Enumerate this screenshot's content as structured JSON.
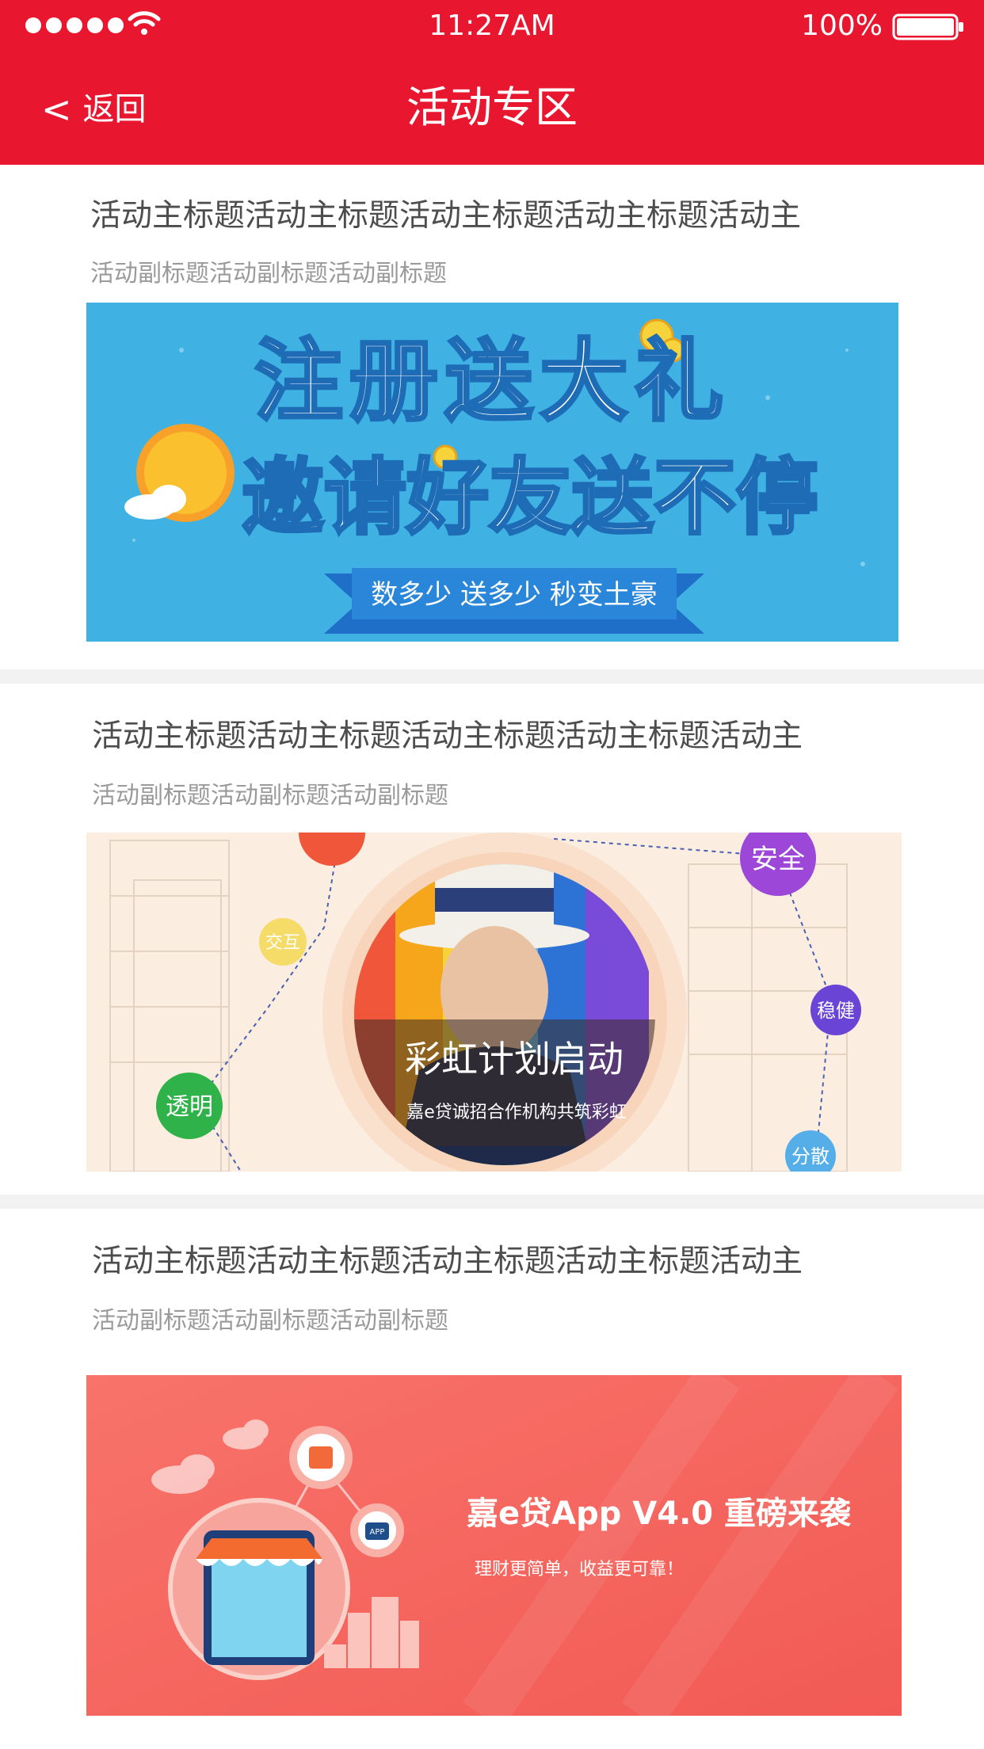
{
  "status_bar": {
    "time": "11:27AM",
    "battery_percent": "100%",
    "signal_icon": "signal-dots-icon",
    "wifi_icon": "wifi-icon",
    "battery_icon": "battery-icon"
  },
  "nav": {
    "back_icon": "<",
    "back_label": "返回",
    "title": "活动专区"
  },
  "colors": {
    "brand_red": "#e8172f",
    "divider": "#f2f2f2",
    "title_text": "#4d4d4d",
    "subtitle_text": "#9a9a9a"
  },
  "activities": [
    {
      "title": "活动主标题活动主标题活动主标题活动主标题活动主",
      "subtitle": "活动副标题活动副标题活动副标题",
      "banner": {
        "headline1": "注册送大礼",
        "headline2": "邀请好友送不停",
        "ribbon": "数多少 送多少 秒变土豪"
      }
    },
    {
      "title": "活动主标题活动主标题活动主标题活动主标题活动主",
      "subtitle": "活动副标题活动副标题活动副标题",
      "banner": {
        "headline": "彩虹计划启动",
        "subline": "嘉e贷诚招合作机构共筑彩虹",
        "tags": [
          "安全",
          "稳健",
          "分散",
          "透明",
          "交互"
        ]
      }
    },
    {
      "title": "活动主标题活动主标题活动主标题活动主标题活动主",
      "subtitle": "活动副标题活动副标题活动副标题",
      "banner": {
        "headline": "嘉e贷App V4.0 重磅来袭",
        "subline": "理财更简单，收益更可靠！",
        "app_badge": "APP"
      }
    }
  ]
}
